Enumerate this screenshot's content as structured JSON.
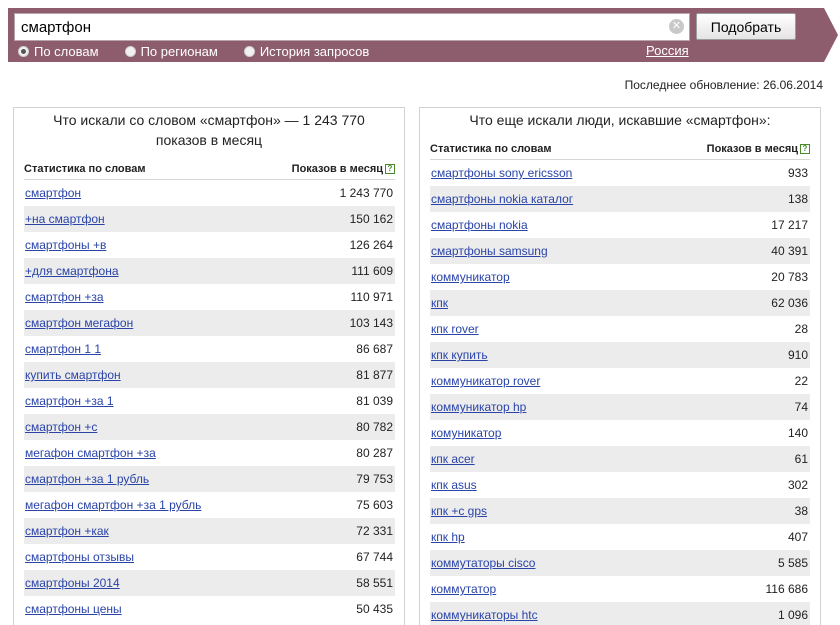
{
  "search": {
    "query": "смартфон",
    "submit_label": "Подобрать",
    "clear_symbol": "✕",
    "modes": [
      {
        "label": "По словам",
        "checked": true
      },
      {
        "label": "По регионам",
        "checked": false
      },
      {
        "label": "История запросов",
        "checked": false
      }
    ],
    "region": "Россия"
  },
  "last_update": "Последнее обновление: 26.06.2014",
  "left_panel": {
    "title": "Что искали со словом «смартфон» — 1 243 770 показов в месяц",
    "col_phrase": "Статистика по словам",
    "col_count": "Показов в месяц",
    "help": "?",
    "rows": [
      {
        "phrase": "смартфон",
        "count": "1 243 770"
      },
      {
        "phrase": "+на смартфон",
        "count": "150 162"
      },
      {
        "phrase": "смартфоны +в",
        "count": "126 264"
      },
      {
        "phrase": "+для смартфона",
        "count": "111 609"
      },
      {
        "phrase": "смартфон +за",
        "count": "110 971"
      },
      {
        "phrase": "смартфон мегафон",
        "count": "103 143"
      },
      {
        "phrase": "смартфон 1 1",
        "count": "86 687"
      },
      {
        "phrase": "купить смартфон",
        "count": "81 877"
      },
      {
        "phrase": "смартфон +за 1",
        "count": "81 039"
      },
      {
        "phrase": "смартфон +с",
        "count": "80 782"
      },
      {
        "phrase": "мегафон смартфон +за",
        "count": "80 287"
      },
      {
        "phrase": "смартфон +за 1 рубль",
        "count": "79 753"
      },
      {
        "phrase": "мегафон смартфон +за 1 рубль",
        "count": "75 603"
      },
      {
        "phrase": "смартфон +как",
        "count": "72 331"
      },
      {
        "phrase": "смартфоны отзывы",
        "count": "67 744"
      },
      {
        "phrase": "смартфоны 2014",
        "count": "58 551"
      },
      {
        "phrase": "смартфоны цены",
        "count": "50 435"
      }
    ]
  },
  "right_panel": {
    "title": "Что еще искали люди, искавшие «смартфон»:",
    "col_phrase": "Статистика по словам",
    "col_count": "Показов в месяц",
    "help": "?",
    "rows": [
      {
        "phrase": "смартфоны sony ericsson",
        "count": "933"
      },
      {
        "phrase": "смартфоны nokia каталог",
        "count": "138"
      },
      {
        "phrase": "смартфоны nokia",
        "count": "17 217"
      },
      {
        "phrase": "смартфоны samsung",
        "count": "40 391"
      },
      {
        "phrase": "коммуникатор",
        "count": "20 783"
      },
      {
        "phrase": "кпк",
        "count": "62 036"
      },
      {
        "phrase": "кпк rover",
        "count": "28"
      },
      {
        "phrase": "кпк купить",
        "count": "910"
      },
      {
        "phrase": "коммуникатор rover",
        "count": "22"
      },
      {
        "phrase": "коммуникатор hp",
        "count": "74"
      },
      {
        "phrase": "комуникатор",
        "count": "140"
      },
      {
        "phrase": "кпк acer",
        "count": "61"
      },
      {
        "phrase": "кпк asus",
        "count": "302"
      },
      {
        "phrase": "кпк +с gps",
        "count": "38"
      },
      {
        "phrase": "кпк hp",
        "count": "407"
      },
      {
        "phrase": "коммутаторы cisco",
        "count": "5 585"
      },
      {
        "phrase": "коммутатор",
        "count": "116 686"
      },
      {
        "phrase": "коммуникаторы htc",
        "count": "1 096"
      }
    ]
  }
}
